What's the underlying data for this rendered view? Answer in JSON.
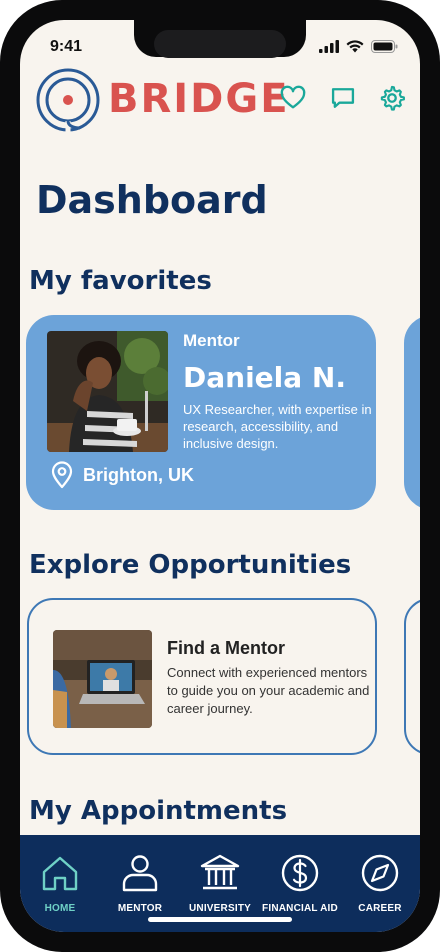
{
  "status": {
    "time": "9:41"
  },
  "header": {
    "brand": "BRIDGE",
    "brand_color": "#d9534f",
    "icons": [
      "heart-icon",
      "chat-icon",
      "gear-icon"
    ],
    "accent_color": "#1aa89a"
  },
  "page": {
    "title": "Dashboard"
  },
  "favorites": {
    "section_title": "My favorites",
    "card": {
      "role": "Mentor",
      "name": "Daniela N.",
      "description": "UX Researcher, with expertise in research, accessibility, and inclusive design.",
      "location": "Brighton, UK",
      "color": "#6ca3d9"
    }
  },
  "opportunities": {
    "section_title": "Explore Opportunities",
    "card": {
      "title": "Find a Mentor",
      "description": "Connect with experienced mentors to guide you on your academic and career journey."
    }
  },
  "appointments": {
    "section_title": "My Appointments"
  },
  "nav": {
    "background": "#0d2d5c",
    "active_color": "#6fd1c6",
    "items": [
      {
        "label": "HOME",
        "icon": "home-icon",
        "active": true
      },
      {
        "label": "MENTOR",
        "icon": "person-icon",
        "active": false
      },
      {
        "label": "UNIVERSITY",
        "icon": "university-icon",
        "active": false
      },
      {
        "label": "FINANCIAL AID",
        "icon": "dollar-icon",
        "active": false
      },
      {
        "label": "CAREER",
        "icon": "compass-icon",
        "active": false
      }
    ]
  }
}
